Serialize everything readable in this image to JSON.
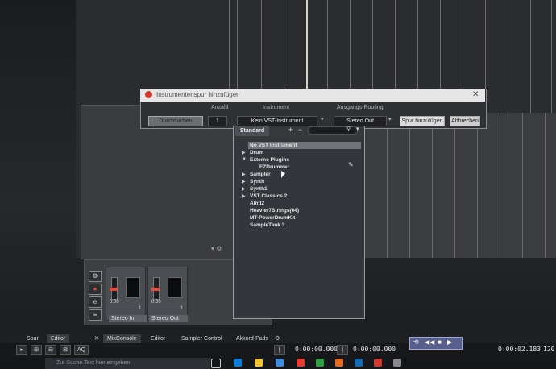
{
  "dialog": {
    "title": "Instrumentenspur hinzufügen",
    "col_count": "Anzahl",
    "col_instrument": "Instrument",
    "col_routing": "Ausgangs-Routing",
    "browse_button": "Durchsuchen",
    "count_value": "1",
    "instrument_value": "Kein VST-Instrument",
    "routing_value": "Stereo Out",
    "add_track_button": "Spur hinzufügen",
    "cancel_button": "Abbrechen",
    "close_glyph": "✕"
  },
  "dropdown": {
    "tab": "Standard",
    "plus": "+",
    "minus": "−",
    "items": [
      {
        "label": "No VST Instrument",
        "arrow": ""
      },
      {
        "label": "Drum",
        "arrow": "▶"
      },
      {
        "label": "Externe Plugins",
        "arrow": "▼"
      },
      {
        "label": "EZDrummer",
        "arrow": ""
      },
      {
        "label": "Sampler",
        "arrow": "▶"
      },
      {
        "label": "Synth",
        "arrow": "▶"
      },
      {
        "label": "Synth1",
        "arrow": "▶"
      },
      {
        "label": "VST Classics 2",
        "arrow": "▶"
      },
      {
        "label": "AIntl2",
        "arrow": ""
      },
      {
        "label": "Heavier7Strings(64)",
        "arrow": ""
      },
      {
        "label": "MT-PowerDrumKit",
        "arrow": ""
      },
      {
        "label": "SampleTank 3",
        "arrow": ""
      }
    ]
  },
  "mixer": {
    "strip1": {
      "value": "0.00",
      "name": "Stereo In",
      "num": "1"
    },
    "strip2": {
      "value": "0.00",
      "name": "Stereo Out",
      "num": "1"
    }
  },
  "tabs": {
    "spur": "Spur",
    "editor": "Editor",
    "mixconsole": "MixConsole",
    "editor2": "Editor",
    "sampler": "Sampler Control",
    "akkord": "Akkord-Pads"
  },
  "transport": {
    "tc1": "0:00:00.000",
    "tc2": "0:00:00.000",
    "tc3": "0:00:02.183",
    "tempo": "120.0",
    "aq": "AQ"
  },
  "taskbar": {
    "search_placeholder": "Zur Suche Text hier eingeben"
  },
  "colors": {
    "accent_red": "#d03a2c",
    "transport_blue": "#585f8c"
  }
}
